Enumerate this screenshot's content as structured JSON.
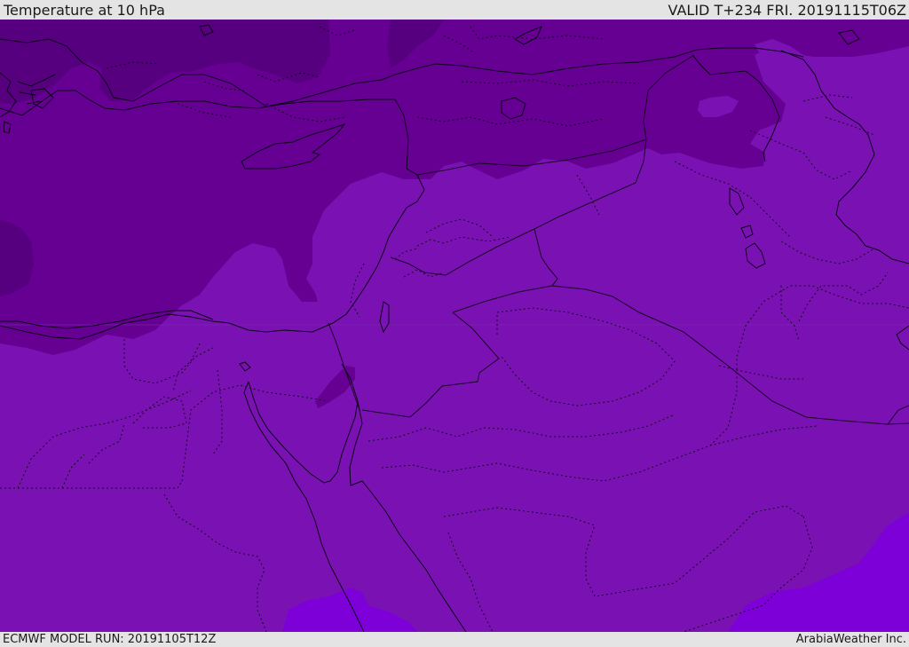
{
  "header": {
    "title": "Temperature at 10 hPa",
    "valid": "VALID T+234 FRI. 20191115T06Z"
  },
  "footer": {
    "model_run": "ECMWF MODEL RUN: 20191105T12Z",
    "brand": "ArabiaWeather Inc."
  },
  "map": {
    "field": "temperature",
    "level": "10 hPa",
    "colors": {
      "base": "#7a12b3",
      "band_dark": "#650092",
      "band_darker": "#560080",
      "band_light": "#7d00d8",
      "coast": "#0c0018",
      "border": "#1a0026"
    }
  }
}
